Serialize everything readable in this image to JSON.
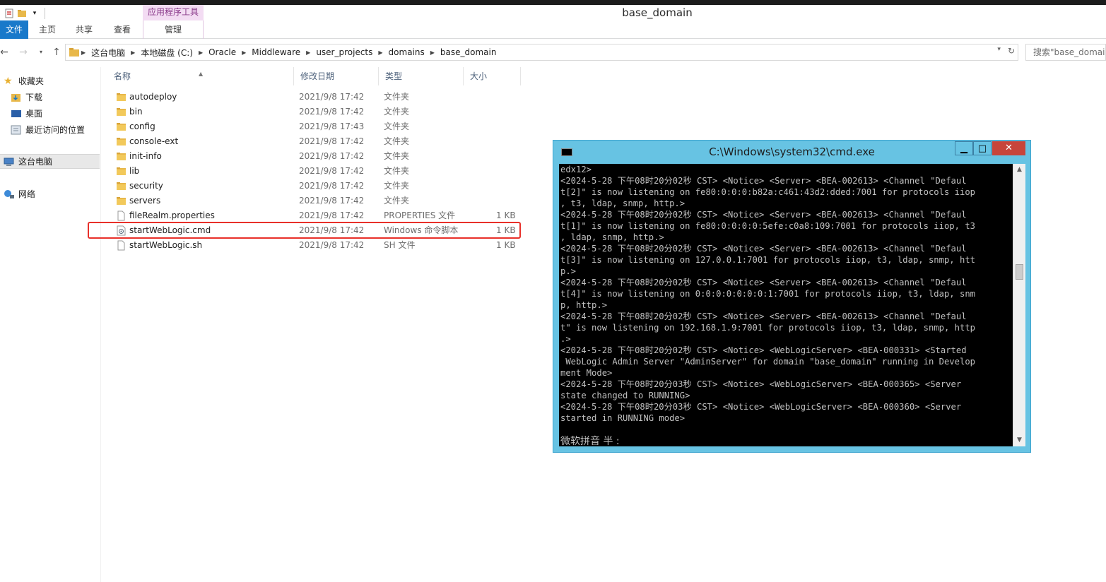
{
  "window": {
    "title": "base_domain",
    "app_tools_tab": "应用程序工具"
  },
  "ribbon": {
    "tabs": [
      "文件",
      "主页",
      "共享",
      "查看",
      "管理"
    ]
  },
  "address": {
    "crumbs": [
      "这台电脑",
      "本地磁盘 (C:)",
      "Oracle",
      "Middleware",
      "user_projects",
      "domains",
      "base_domain"
    ],
    "search_placeholder": "搜索\"base_domain\""
  },
  "nav": {
    "favorites": "收藏夹",
    "downloads": "下载",
    "desktop": "桌面",
    "recent": "最近访问的位置",
    "this_pc": "这台电脑",
    "network": "网络"
  },
  "columns": {
    "name": "名称",
    "date": "修改日期",
    "type": "类型",
    "size": "大小"
  },
  "files": [
    {
      "name": "autodeploy",
      "date": "2021/9/8 17:42",
      "type": "文件夹",
      "size": "",
      "kind": "folder"
    },
    {
      "name": "bin",
      "date": "2021/9/8 17:42",
      "type": "文件夹",
      "size": "",
      "kind": "folder"
    },
    {
      "name": "config",
      "date": "2021/9/8 17:43",
      "type": "文件夹",
      "size": "",
      "kind": "folder"
    },
    {
      "name": "console-ext",
      "date": "2021/9/8 17:42",
      "type": "文件夹",
      "size": "",
      "kind": "folder"
    },
    {
      "name": "init-info",
      "date": "2021/9/8 17:42",
      "type": "文件夹",
      "size": "",
      "kind": "folder"
    },
    {
      "name": "lib",
      "date": "2021/9/8 17:42",
      "type": "文件夹",
      "size": "",
      "kind": "folder"
    },
    {
      "name": "security",
      "date": "2021/9/8 17:42",
      "type": "文件夹",
      "size": "",
      "kind": "folder"
    },
    {
      "name": "servers",
      "date": "2021/9/8 17:42",
      "type": "文件夹",
      "size": "",
      "kind": "folder"
    },
    {
      "name": "fileRealm.properties",
      "date": "2021/9/8 17:42",
      "type": "PROPERTIES 文件",
      "size": "1 KB",
      "kind": "file"
    },
    {
      "name": "startWebLogic.cmd",
      "date": "2021/9/8 17:42",
      "type": "Windows 命令脚本",
      "size": "1 KB",
      "kind": "cmd"
    },
    {
      "name": "startWebLogic.sh",
      "date": "2021/9/8 17:42",
      "type": "SH 文件",
      "size": "1 KB",
      "kind": "file"
    }
  ],
  "cmd": {
    "title": "C:\\Windows\\system32\\cmd.exe",
    "lines": [
      "edx12>",
      "<2024-5-28 下午08时20分02秒 CST> <Notice> <Server> <BEA-002613> <Channel \"Defaul",
      "t[2]\" is now listening on fe80:0:0:0:b82a:c461:43d2:dded:7001 for protocols iiop",
      ", t3, ldap, snmp, http.>",
      "<2024-5-28 下午08时20分02秒 CST> <Notice> <Server> <BEA-002613> <Channel \"Defaul",
      "t[1]\" is now listening on fe80:0:0:0:0:5efe:c0a8:109:7001 for protocols iiop, t3",
      ", ldap, snmp, http.>",
      "<2024-5-28 下午08时20分02秒 CST> <Notice> <Server> <BEA-002613> <Channel \"Defaul",
      "t[3]\" is now listening on 127.0.0.1:7001 for protocols iiop, t3, ldap, snmp, htt",
      "p.>",
      "<2024-5-28 下午08时20分02秒 CST> <Notice> <Server> <BEA-002613> <Channel \"Defaul",
      "t[4]\" is now listening on 0:0:0:0:0:0:0:1:7001 for protocols iiop, t3, ldap, snm",
      "p, http.>",
      "<2024-5-28 下午08时20分02秒 CST> <Notice> <Server> <BEA-002613> <Channel \"Defaul",
      "t\" is now listening on 192.168.1.9:7001 for protocols iiop, t3, ldap, snmp, http",
      ".>",
      "<2024-5-28 下午08时20分02秒 CST> <Notice> <WebLogicServer> <BEA-000331> <Started",
      " WebLogic Admin Server \"AdminServer\" for domain \"base_domain\" running in Develop",
      "ment Mode>",
      "<2024-5-28 下午08时20分03秒 CST> <Notice> <WebLogicServer> <BEA-000365> <Server",
      "state changed to RUNNING>",
      "<2024-5-28 下午08时20分03秒 CST> <Notice> <WebLogicServer> <BEA-000360> <Server",
      "started in RUNNING mode>"
    ],
    "ime": "微软拼音 半 :"
  },
  "colors": {
    "file_tab": "#1979ca",
    "highlight_box": "#e8302a",
    "cmd_frame": "#67c3e3",
    "close_button": "#c7453b",
    "folder": "#e8b84a"
  }
}
